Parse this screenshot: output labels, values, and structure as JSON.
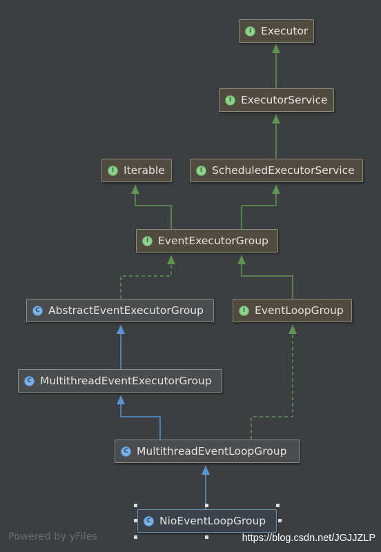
{
  "nodes": {
    "executor": {
      "label": "Executor",
      "kind": "I"
    },
    "executor_service": {
      "label": "ExecutorService",
      "kind": "I"
    },
    "iterable": {
      "label": "Iterable",
      "kind": "I"
    },
    "scheduled_executor_service": {
      "label": "ScheduledExecutorService",
      "kind": "I"
    },
    "event_executor_group": {
      "label": "EventExecutorGroup",
      "kind": "I"
    },
    "abstract_event_executor_group": {
      "label": "AbstractEventExecutorGroup",
      "kind": "C"
    },
    "event_loop_group": {
      "label": "EventLoopGroup",
      "kind": "I"
    },
    "multithread_event_executor_group": {
      "label": "MultithreadEventExecutorGroup",
      "kind": "C"
    },
    "multithread_event_loop_group": {
      "label": "MultithreadEventLoopGroup",
      "kind": "C"
    },
    "nio_event_loop_group": {
      "label": "NioEventLoopGroup",
      "kind": "C"
    }
  },
  "edges": [
    {
      "from": "executor_service",
      "to": "executor",
      "style": "extends-interface"
    },
    {
      "from": "scheduled_executor_service",
      "to": "executor_service",
      "style": "extends-interface"
    },
    {
      "from": "event_executor_group",
      "to": "iterable",
      "style": "extends-interface"
    },
    {
      "from": "event_executor_group",
      "to": "scheduled_executor_service",
      "style": "extends-interface"
    },
    {
      "from": "abstract_event_executor_group",
      "to": "event_executor_group",
      "style": "implements"
    },
    {
      "from": "event_loop_group",
      "to": "event_executor_group",
      "style": "extends-interface"
    },
    {
      "from": "multithread_event_executor_group",
      "to": "abstract_event_executor_group",
      "style": "extends-class"
    },
    {
      "from": "multithread_event_loop_group",
      "to": "multithread_event_executor_group",
      "style": "extends-class"
    },
    {
      "from": "multithread_event_loop_group",
      "to": "event_loop_group",
      "style": "implements"
    },
    {
      "from": "nio_event_loop_group",
      "to": "multithread_event_loop_group",
      "style": "extends-class"
    }
  ],
  "colors": {
    "background": "#3c3f41",
    "interface_edge": "#5f9553",
    "class_edge": "#5b93d6"
  },
  "footer": {
    "watermark": "Powered by yFiles",
    "credit": "https://blog.csdn.net/JGJJZLP"
  }
}
